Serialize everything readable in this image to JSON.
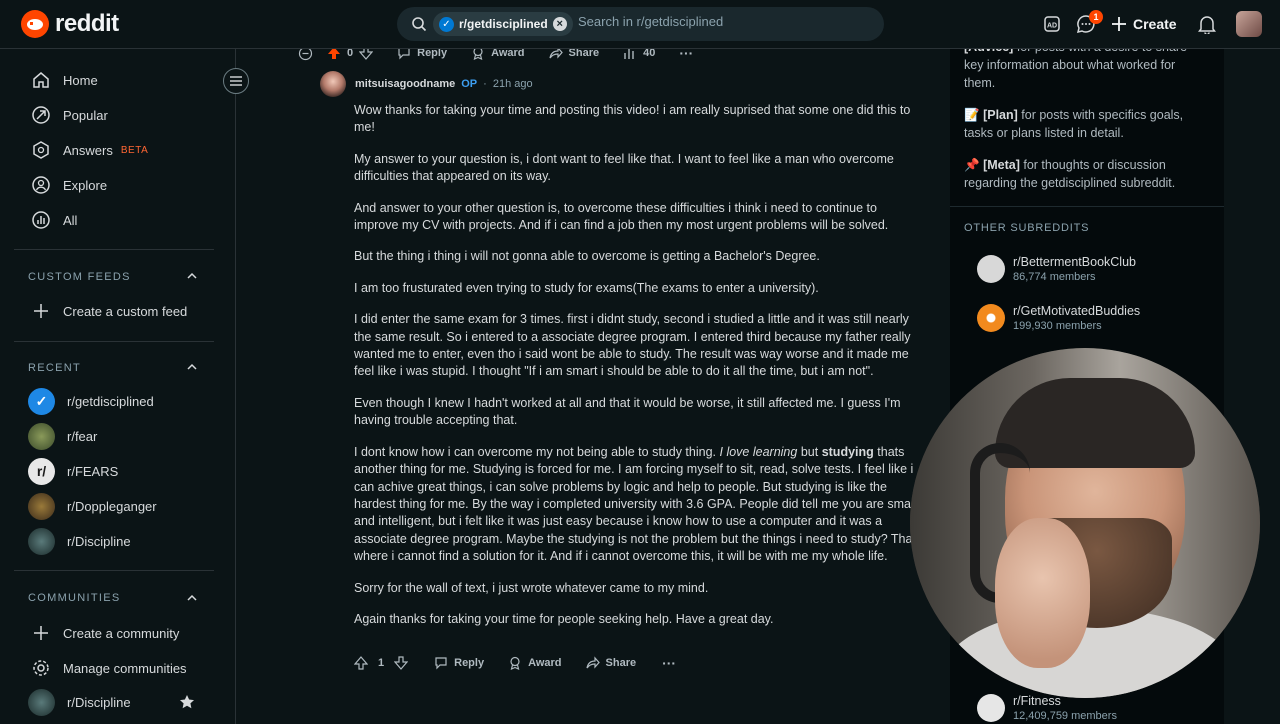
{
  "header": {
    "logo_text": "reddit",
    "search_chip": "r/getdisciplined",
    "search_placeholder": "Search in r/getdisciplined",
    "notification_count": "1",
    "create_label": "Create"
  },
  "sidebar": {
    "nav": [
      {
        "label": "Home",
        "icon": "home-icon"
      },
      {
        "label": "Popular",
        "icon": "popular-icon"
      },
      {
        "label": "Answers",
        "icon": "answers-icon",
        "badge": "BETA"
      },
      {
        "label": "Explore",
        "icon": "explore-icon"
      },
      {
        "label": "All",
        "icon": "all-icon"
      }
    ],
    "custom_feeds_title": "CUSTOM FEEDS",
    "create_custom_feed": "Create a custom feed",
    "recent_title": "RECENT",
    "recent": [
      {
        "label": "r/getdisciplined",
        "color": "#1e88e5"
      },
      {
        "label": "r/fear",
        "color": "#4a5a3a"
      },
      {
        "label": "r/FEARS",
        "color": "#e8e8e8"
      },
      {
        "label": "r/Doppleganger",
        "color": "#5a4a2a"
      },
      {
        "label": "r/Discipline",
        "color": "#2e4a4a"
      }
    ],
    "communities_title": "COMMUNITIES",
    "create_community": "Create a community",
    "manage_communities": "Manage communities",
    "community_discipline": "r/Discipline"
  },
  "post_actions": {
    "votes": "0",
    "reply": "Reply",
    "award": "Award",
    "share": "Share",
    "count": "40"
  },
  "comment": {
    "author": "mitsuisagoodname",
    "op_badge": "OP",
    "time": "21h ago",
    "paragraphs": {
      "p1": "Wow thanks for taking your time and posting this video! i am really suprised that some one did this to me!",
      "p2": "My answer to your question is, i dont want to feel like that. I want to feel like a man who overcome difficulties that appeared on its way.",
      "p3": "And answer to your other question is, to overcome these difficulties i think i need to continue to improve my CV with projects. And if i can find a job then my most urgent problems will be solved.",
      "p4": "But the thing i thing i will not gonna able to overcome is getting a Bachelor's Degree.",
      "p5": "I am too frusturated even trying to study for exams(The exams to enter a university).",
      "p6": "I did enter the same exam for 3 times. first i didnt study, second i studied a little and it was still nearly the same result. So i entered to a associate degree program. I entered third because my father really wanted me to enter, even tho i said wont be able to study. The result was way worse and it made me feel like i was stupid. I thought \"If i am smart i should be able to do it all the time, but i am not\".",
      "p7": "Even though I knew I hadn't worked at all and that it would be worse, it still affected me. I guess I'm having trouble accepting that.",
      "p8_a": "I dont know how i can overcome my not being able to study thing.",
      "p8_em": "I love learning",
      "p8_b": "but",
      "p8_strong": "studying",
      "p8_c": "thats another thing for me. Studying is forced for me. I am forcing myself to sit, read, solve tests. I feel like i can achive great things, i can solve problems by logic and help to people. But studying is like the hardest thing for me. By the way i completed university with 3.6 GPA. People did tell me you are smart and intelligent, but i felt like it was just easy because i know how to use a computer and it was a associate degree program. Maybe the studying is not the problem but the things i need to study? Thats where i cannot find a solution for it. And if i cannot overcome this, it will be with me my whole life.",
      "p9": "Sorry for the wall of text, i just wrote whatever came to my mind.",
      "p10": "Again thanks for taking your time for people seeking help. Have a great day."
    },
    "votes": "1",
    "reply": "Reply",
    "award": "Award",
    "share": "Share"
  },
  "right_sidebar": {
    "learned_text": "for posts with a desire to share key information about what worked for them.",
    "learned_label": "[Advice]",
    "plan_emoji": "📝",
    "plan_label": "[Plan]",
    "plan_text": "for posts with specifics goals, tasks or plans listed in detail.",
    "meta_emoji": "📌",
    "meta_label": "[Meta]",
    "meta_text": "for thoughts or discussion regarding the getdisciplined subreddit.",
    "other_title": "OTHER SUBREDDITS",
    "subs": [
      {
        "name": "r/BettermentBookClub",
        "members": "86,774 members",
        "color": "#d8d8d8"
      },
      {
        "name": "r/GetMotivatedBuddies",
        "members": "199,930 members",
        "color": "#f28a1e"
      },
      {
        "name": "r/Fitness",
        "members": "12,409,759 members",
        "color": "#e6e6e6"
      }
    ]
  }
}
